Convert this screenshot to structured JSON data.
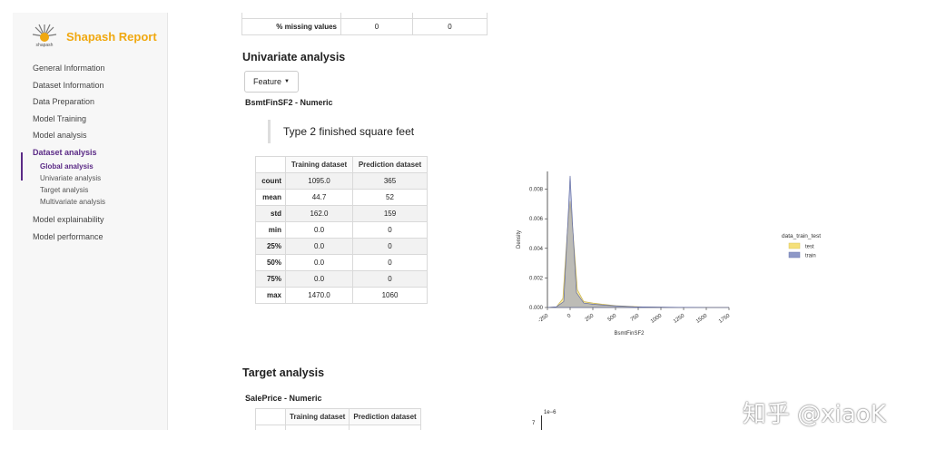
{
  "sidebar": {
    "logo_text": "Shapash Report",
    "logo_small": "shapash",
    "items": [
      "General Information",
      "Dataset Information",
      "Data Preparation",
      "Model Training",
      "Model analysis"
    ],
    "active_item": "Dataset analysis",
    "subitems": [
      "Global analysis",
      "Univariate analysis",
      "Target analysis",
      "Multivariate analysis"
    ],
    "items_after": [
      "Model explainability",
      "Model performance"
    ]
  },
  "top_table": {
    "label": "% missing values",
    "train": "0",
    "test": "0"
  },
  "univariate": {
    "heading": "Univariate analysis",
    "feature_button": "Feature",
    "feature_title": "BsmtFinSF2 - Numeric",
    "description": "Type 2 finished square feet",
    "table": {
      "headers": [
        "Training dataset",
        "Prediction dataset"
      ],
      "rows": [
        {
          "stat": "count",
          "train": "1095.0",
          "test": "365"
        },
        {
          "stat": "mean",
          "train": "44.7",
          "test": "52"
        },
        {
          "stat": "std",
          "train": "162.0",
          "test": "159"
        },
        {
          "stat": "min",
          "train": "0.0",
          "test": "0"
        },
        {
          "stat": "25%",
          "train": "0.0",
          "test": "0"
        },
        {
          "stat": "50%",
          "train": "0.0",
          "test": "0"
        },
        {
          "stat": "75%",
          "train": "0.0",
          "test": "0"
        },
        {
          "stat": "max",
          "train": "1470.0",
          "test": "1060"
        }
      ]
    }
  },
  "chart_data": {
    "type": "area",
    "xlabel": "BsmtFinSF2",
    "ylabel": "Density",
    "xticks": [
      "-250",
      "0",
      "250",
      "500",
      "750",
      "1000",
      "1250",
      "1500",
      "1750"
    ],
    "yticks": [
      "0.000",
      "0.002",
      "0.004",
      "0.006",
      "0.008"
    ],
    "xlim": [
      -250,
      1750
    ],
    "ylim": [
      0,
      0.0092
    ],
    "legend_title": "data_train_test",
    "legend_position": "right",
    "series": [
      {
        "name": "test",
        "color": "#f5e07a",
        "points": [
          [
            -250,
            0
          ],
          [
            -150,
            5e-05
          ],
          [
            -80,
            0.0006
          ],
          [
            -30,
            0.0052
          ],
          [
            0,
            0.0072
          ],
          [
            30,
            0.0052
          ],
          [
            80,
            0.0012
          ],
          [
            150,
            0.0004
          ],
          [
            250,
            0.0003
          ],
          [
            350,
            0.00022
          ],
          [
            500,
            0.00012
          ],
          [
            650,
            8e-05
          ],
          [
            800,
            4e-05
          ],
          [
            1000,
            2e-05
          ],
          [
            1200,
            0
          ],
          [
            1750,
            0
          ]
        ]
      },
      {
        "name": "train",
        "color": "#8d98c7",
        "points": [
          [
            -250,
            0
          ],
          [
            -150,
            5e-05
          ],
          [
            -70,
            0.0004
          ],
          [
            -25,
            0.0058
          ],
          [
            0,
            0.0089
          ],
          [
            25,
            0.0058
          ],
          [
            70,
            0.001
          ],
          [
            150,
            0.0003
          ],
          [
            250,
            0.00022
          ],
          [
            400,
            0.00015
          ],
          [
            550,
            9e-05
          ],
          [
            700,
            5e-05
          ],
          [
            900,
            3e-05
          ],
          [
            1200,
            1e-05
          ],
          [
            1500,
            0
          ],
          [
            1750,
            0
          ]
        ]
      }
    ]
  },
  "target": {
    "heading": "Target analysis",
    "title": "SalePrice - Numeric",
    "headers": [
      "Training dataset",
      "Prediction dataset"
    ],
    "chart_label": "1e−6",
    "chart_tick": "7"
  },
  "watermark": "知乎 @xiaoK"
}
